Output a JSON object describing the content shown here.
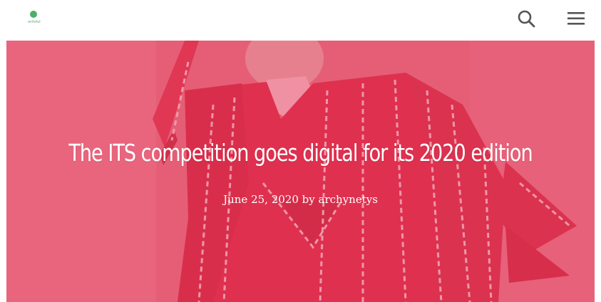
{
  "header": {
    "logo_text": "writeful",
    "search_icon": "search-icon",
    "menu_icon": "hamburger-menu-icon"
  },
  "hero": {
    "title": "The ITS competition goes digital for its 2020 edition",
    "date": "June 25, 2020",
    "by": "by",
    "author": "archynetys",
    "overlay_color": "#e25a72",
    "image_description_colors": {
      "garment": "#d81e3c",
      "stripes": "#f6d6dc"
    }
  }
}
